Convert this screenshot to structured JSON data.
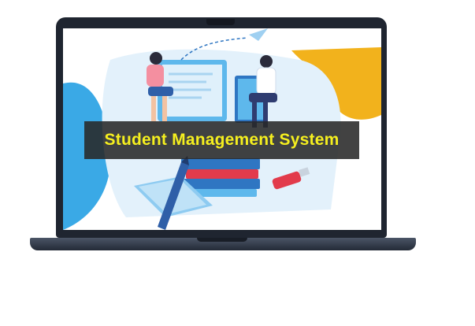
{
  "banner": {
    "title": "Student Management System"
  },
  "colors": {
    "title_text": "#f5ef1f",
    "banner_bg": "#282828",
    "bezel": "#1f2530",
    "accent_blue": "#3aa9e6",
    "accent_yellow": "#f2b21c"
  },
  "icons": [
    "paper-plane-icon",
    "pen-icon",
    "usb-drive-icon",
    "book-stack-icon",
    "student-figure-icon",
    "keyboard-icon",
    "monitor-icon"
  ]
}
